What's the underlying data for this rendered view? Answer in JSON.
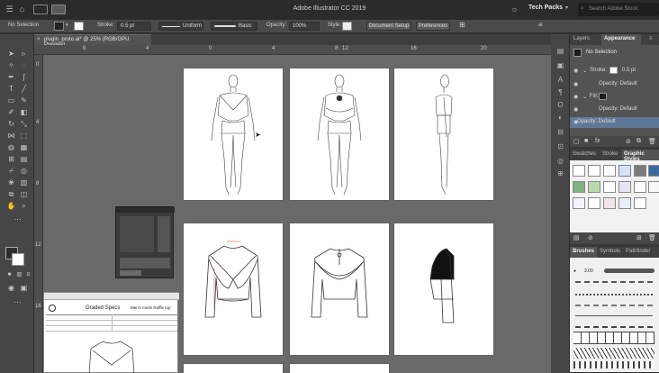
{
  "titlebar": {
    "title": "Adobe Illustrator CC 2019",
    "workspace": "Tech Packs",
    "search_placeholder": "Search Adobe Stock"
  },
  "control_bar": {
    "selection": "No Selection",
    "stroke_label": "Stroke:",
    "stroke_value": "0.5 pt",
    "profile": "Uniform",
    "brush": "Basic",
    "opacity_label": "Opacity:",
    "opacity_value": "100%",
    "style_label": "Style:",
    "document_setup": "Document Setup",
    "preferences": "Preferences"
  },
  "document_tab": {
    "name": "plugin_proto.ai* @ 25% (RGB/GPU Preview)"
  },
  "ruler": {
    "h_ticks": [
      "8",
      "4",
      "0",
      "4",
      "8",
      "12",
      "16",
      "20"
    ],
    "v_ticks": [
      "0",
      "4",
      "8",
      "12",
      "16"
    ]
  },
  "spec_sheet": {
    "title": "Graded Specs",
    "subtitle": "Men's mesh Ruffle top"
  },
  "appearance_panel": {
    "tabs": [
      "Layers",
      "Appearance"
    ],
    "rows": {
      "no_selection": "No Selection",
      "stroke_label": "Stroke:",
      "stroke_value": "0.5 pt",
      "opacity1": "Opacity: Default",
      "fill_label": "Fill:",
      "opacity2": "Opacity: Default",
      "opacity3": "Opacity: Default"
    }
  },
  "styles_panel": {
    "tabs": [
      "Swatches",
      "Stroke",
      "Graphic Styles"
    ]
  },
  "brushes_panel": {
    "tabs": [
      "Brushes",
      "Symbols",
      "Pathfinder"
    ],
    "first_brush": "3.00"
  },
  "colors": {
    "accent": "#4f7fb0",
    "canvas": "#696969",
    "panel": "#535353"
  }
}
